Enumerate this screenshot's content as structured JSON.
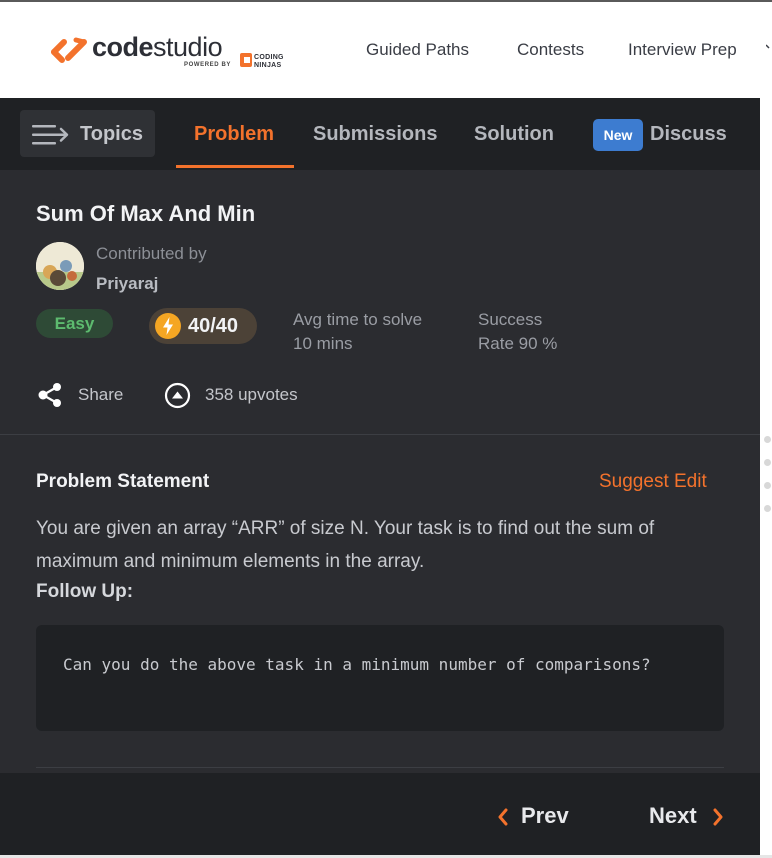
{
  "brand": {
    "name_bold": "code",
    "name_light": "studio",
    "powered_by": "POWERED BY",
    "partner_line1": "CODING",
    "partner_line2": "NINJAS"
  },
  "nav": {
    "links": [
      "Guided Paths",
      "Contests",
      "Interview Prep"
    ]
  },
  "tabs": {
    "topics_label": "Topics",
    "items": [
      "Problem",
      "Submissions",
      "Solution",
      "Discuss"
    ],
    "active": "Problem",
    "new_badge": "New"
  },
  "problem": {
    "title": "Sum Of Max And Min",
    "contributed_label": "Contributed by",
    "contributor": "Priyaraj",
    "difficulty": "Easy",
    "score": "40/40",
    "avg_time_label": "Avg time to solve",
    "avg_time_value": "10 mins",
    "success_label": "Success",
    "success_value": "Rate 90 %",
    "share_label": "Share",
    "upvotes": "358 upvotes"
  },
  "statement": {
    "heading": "Problem Statement",
    "suggest_edit": "Suggest Edit",
    "text": "You are given an array “ARR” of size N. Your task is to find out the sum of maximum and minimum elements in the array.",
    "follow_up_label": "Follow Up:",
    "follow_up_code": "Can you do the above task in a minimum number of comparisons?"
  },
  "footer": {
    "prev_label": "Prev",
    "next_label": "Next"
  },
  "colors": {
    "accent": "#f3722c",
    "easy": "#5dbb6f",
    "new_badge": "#3d7cd0"
  }
}
